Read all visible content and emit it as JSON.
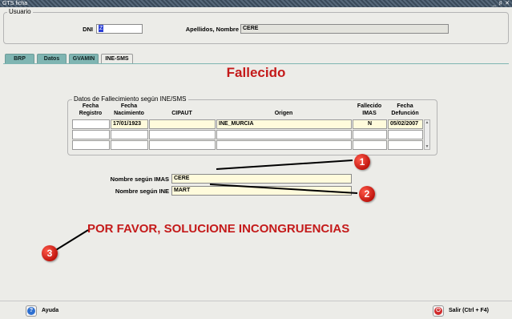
{
  "window": {
    "title": "GTS ficha",
    "controls": "_ ♯ ✕"
  },
  "usuario": {
    "group_label": "Usuario",
    "dni_label": "DNI",
    "dni_value": "Z",
    "apellidos_label": "Apellidos, Nombre",
    "apellidos_value": "CERE"
  },
  "tabs": [
    {
      "label": "BRP",
      "active": false
    },
    {
      "label": "Datos",
      "active": false
    },
    {
      "label": "GVAMIN",
      "active": false
    },
    {
      "label": "INE-SMS",
      "active": true
    }
  ],
  "panel": {
    "heading": "Fallecido",
    "group_label": "Datos de Fallecimiento según INE/SMS",
    "columns": {
      "fecha_registro": "Fecha\nRegistro",
      "fecha_nacimiento": "Fecha\nNacimiento",
      "cipaut": "CIPAUT",
      "origen": "Origen",
      "fallecido_imas": "Fallecido\nIMAS",
      "fecha_defuncion": "Fecha\nDefunción"
    },
    "rows": [
      {
        "fecha_registro": "",
        "fecha_nacimiento": "17/01/1923",
        "cipaut": "",
        "origen": "INE_MURCIA",
        "fallecido_imas": "N",
        "fecha_defuncion": "05/02/2007"
      },
      {
        "fecha_registro": "",
        "fecha_nacimiento": "",
        "cipaut": "",
        "origen": "",
        "fallecido_imas": "",
        "fecha_defuncion": ""
      },
      {
        "fecha_registro": "",
        "fecha_nacimiento": "",
        "cipaut": "",
        "origen": "",
        "fallecido_imas": "",
        "fecha_defuncion": ""
      }
    ],
    "nombre_imas_label": "Nombre según IMAS",
    "nombre_imas_value": "CERE",
    "nombre_ine_label": "Nombre según INE",
    "nombre_ine_value": "MART",
    "warning": "POR FAVOR, SOLUCIONE INCONGRUENCIAS"
  },
  "markers": [
    "1",
    "2",
    "3"
  ],
  "annotation_color": "#000000",
  "accent_red": "#c41a1a",
  "tab_color": "#7fb5b2",
  "footer": {
    "help_label": "Ayuda",
    "help_icon": "help-icon",
    "exit_label": "Salir (Ctrl + F4)",
    "exit_icon": "exit-icon"
  }
}
